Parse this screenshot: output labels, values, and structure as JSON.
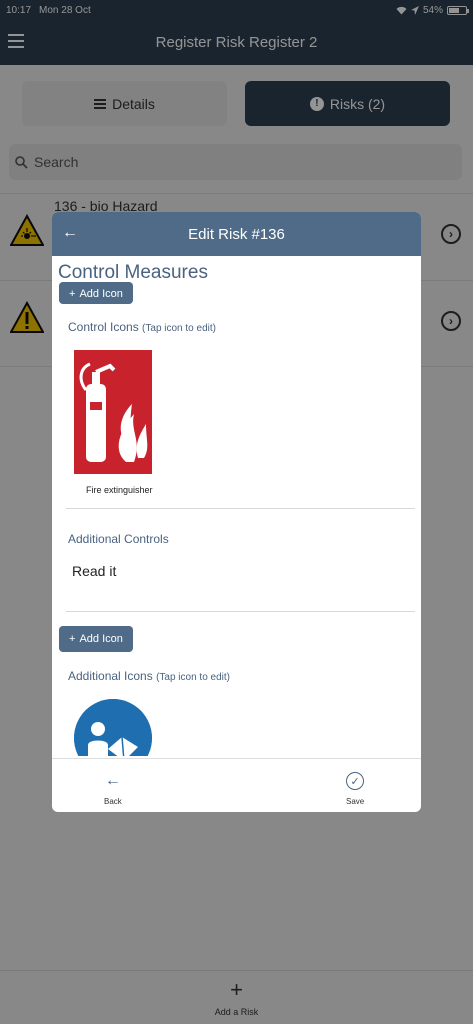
{
  "status_bar": {
    "time": "10:17",
    "date": "Mon 28 Oct",
    "battery": "54%"
  },
  "app_bar": {
    "title": "Register Risk Register 2"
  },
  "tabs": [
    {
      "label": "Details",
      "icon": "list-icon"
    },
    {
      "label": "Risks (2)",
      "icon": "alert-icon",
      "badge": "!"
    }
  ],
  "search": {
    "placeholder": "Search"
  },
  "risk_rows": [
    {
      "title": "136 - bio Hazard",
      "icon": "laser-warning-icon"
    },
    {
      "title": "",
      "icon": "general-warning-icon"
    }
  ],
  "bottom_bar": {
    "add_label": "Add a Risk",
    "plus": "+"
  },
  "modal": {
    "title": "Edit Risk #136",
    "back_glyph": "←",
    "section_heading": "Control Measures",
    "add_icon_label": "Add Icon",
    "control_icons_label": "Control Icons",
    "control_icons_hint": "(Tap icon to edit)",
    "control_icon_caption": "Fire extinguisher",
    "additional_controls_label": "Additional Controls",
    "additional_controls_value": "Read it",
    "additional_icons_label": "Additional Icons",
    "additional_icons_hint": "(Tap icon to edit)",
    "footer": {
      "back_label": "Back",
      "save_label": "Save"
    }
  },
  "colors": {
    "navy": "#2d3f52",
    "header_blue": "#4f6b87",
    "sign_red": "#c8232c",
    "sign_blue": "#1f6fb0",
    "warning_yellow": "#f5c400"
  }
}
